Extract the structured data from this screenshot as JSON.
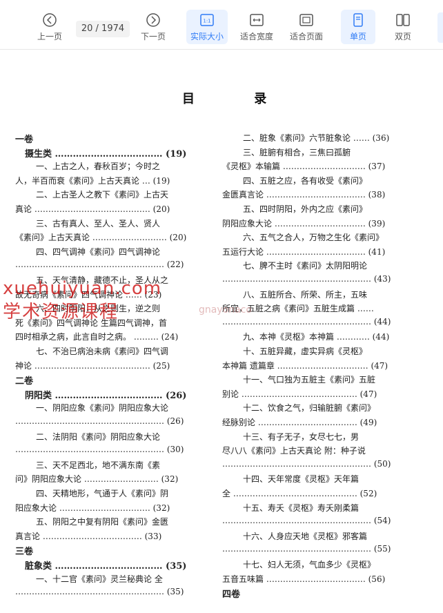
{
  "toolbar": {
    "prev_label": "上一页",
    "page_indicator": "20 / 1974",
    "next_label": "下一页",
    "actual_size_label": "实际大小",
    "fit_width_label": "适合宽度",
    "fit_page_label": "适合页面",
    "single_page_label": "单页",
    "double_page_label": "双页",
    "accent_color": "#2f7bf5"
  },
  "document": {
    "title": "目 录",
    "left_column": [
      {
        "text": "一卷",
        "kind": "vol"
      },
      {
        "text": "摄生类 ……………………………… (19)",
        "kind": "cat"
      },
      {
        "text": "一、上古之人，春秋百岁；今时之",
        "kind": "entry"
      },
      {
        "text": "人，半百而衰《素问》上古天真论 … (19)",
        "kind": "entry"
      },
      {
        "text": "二、上古圣人之教下《素问》上古天",
        "kind": "entry"
      },
      {
        "text": "真论 …………………………………… (20)",
        "kind": "entry"
      },
      {
        "text": "三、古有真人、至人、圣人、贤人",
        "kind": "entry"
      },
      {
        "text": "《素问》上古天真论 ……………………… (20)",
        "kind": "entry"
      },
      {
        "text": "四、四气调神《素问》四气调神论",
        "kind": "entry"
      },
      {
        "text": "……………………………………………… (22)",
        "kind": "entry"
      },
      {
        "text": "五、天气清静，藏德不止，圣人从之",
        "kind": "entry"
      },
      {
        "text": "故无奇病《素问》四气调神论 …… (23)",
        "kind": "entry"
      },
      {
        "text": "六、四时阴阳，从之则生，逆之则",
        "kind": "entry"
      },
      {
        "text": "死《素问》四气调神论 生篇四气调神，首",
        "kind": "entry"
      },
      {
        "text": "四时相承之病，此言自时之病。 ……… (24)",
        "kind": "entry"
      },
      {
        "text": "七、不治已病治未病《素问》四气调",
        "kind": "entry"
      },
      {
        "text": "神论 …………………………………… (25)",
        "kind": "entry"
      },
      {
        "text": "二卷",
        "kind": "vol"
      },
      {
        "text": "阴阳类 ……………………………… (26)",
        "kind": "cat"
      },
      {
        "text": "一、阴阳应象《素问》阴阳应象大论",
        "kind": "entry"
      },
      {
        "text": "……………………………………………… (26)",
        "kind": "entry"
      },
      {
        "text": "二、法阴阳《素问》阴阳应象大论",
        "kind": "entry"
      },
      {
        "text": "……………………………………………… (30)",
        "kind": "entry"
      },
      {
        "text": "三、天不足西北，地不满东南《素",
        "kind": "entry"
      },
      {
        "text": "问》阴阳应象大论 ……………………… (32)",
        "kind": "entry"
      },
      {
        "text": "四、天精地形，气通于人《素问》阴",
        "kind": "entry"
      },
      {
        "text": "阳应象大论 …………………………… (32)",
        "kind": "entry"
      },
      {
        "text": "五、阴阳之中复有阴阳《素问》金匮",
        "kind": "entry"
      },
      {
        "text": "真言论 ……………………………… (33)",
        "kind": "entry"
      },
      {
        "text": "三卷",
        "kind": "vol"
      },
      {
        "text": "脏象类 ……………………………… (35)",
        "kind": "cat"
      },
      {
        "text": "一、十二官《素问》灵兰秘典论 全",
        "kind": "entry"
      },
      {
        "text": "……………………………………………… (35)",
        "kind": "entry"
      }
    ],
    "right_column": [
      {
        "text": "二、脏象《素问》六节脏象论 …… (36)",
        "kind": "entry"
      },
      {
        "text": "三、脏腑有相合，三焦曰孤腑",
        "kind": "entry"
      },
      {
        "text": "《灵枢》本输篇 ………………………… (37)",
        "kind": "entry"
      },
      {
        "text": "四、五脏之应，各有收受《素问》",
        "kind": "entry"
      },
      {
        "text": "金匮真言论 ……………………………… (38)",
        "kind": "entry"
      },
      {
        "text": "五、四时阴阳，外内之应《素问》",
        "kind": "entry"
      },
      {
        "text": "阴阳应象大论 …………………………… (39)",
        "kind": "entry"
      },
      {
        "text": "六、五气之合人，万物之生化《素问》",
        "kind": "entry"
      },
      {
        "text": "五运行大论 ……………………………… (41)",
        "kind": "entry"
      },
      {
        "text": "七、脾不主时《素问》太阴阳明论",
        "kind": "entry"
      },
      {
        "text": "……………………………………………… (43)",
        "kind": "entry"
      },
      {
        "text": "八、五脏所合、所荣、所主，五味",
        "kind": "entry"
      },
      {
        "text": "所宜，五脏之病《素问》五脏生成篇 ……",
        "kind": "entry"
      },
      {
        "text": "……………………………………………… (44)",
        "kind": "entry"
      },
      {
        "text": "九、本神《灵枢》本神篇 ………… (44)",
        "kind": "entry"
      },
      {
        "text": "十、五脏异藏，虚实异病《灵枢》",
        "kind": "entry"
      },
      {
        "text": "本神篇 遗篇章 …………………………… (47)",
        "kind": "entry"
      },
      {
        "text": "十一、气口独为五脏主《素问》五脏",
        "kind": "entry"
      },
      {
        "text": "别论 …………………………………… (47)",
        "kind": "entry"
      },
      {
        "text": "十二、饮食之气，归输脏腑《素问》",
        "kind": "entry"
      },
      {
        "text": "经脉别论 ……………………………… (49)",
        "kind": "entry"
      },
      {
        "text": "十三、有子无子，女尽七七，男",
        "kind": "entry"
      },
      {
        "text": "尽八八《素问》上古天真论 附：种子说",
        "kind": "entry"
      },
      {
        "text": "……………………………………………… (50)",
        "kind": "entry"
      },
      {
        "text": "十四、天年常度《灵枢》天年篇",
        "kind": "entry"
      },
      {
        "text": "全 ……………………………………… (52)",
        "kind": "entry"
      },
      {
        "text": "十五、寿夭《灵枢》寿夭刚柔篇",
        "kind": "entry"
      },
      {
        "text": "……………………………………………… (54)",
        "kind": "entry"
      },
      {
        "text": "十六、人身应天地《灵枢》邪客篇",
        "kind": "entry"
      },
      {
        "text": "……………………………………………… (55)",
        "kind": "entry"
      },
      {
        "text": "十七、妇人无须，气血多少《灵枢》",
        "kind": "entry"
      },
      {
        "text": "五音五味篇 ……………………………… (56)",
        "kind": "entry"
      },
      {
        "text": "四卷",
        "kind": "vol"
      }
    ],
    "watermark_1": "xuehuiyuan.com",
    "watermark_2": "学术资源课程",
    "watermark_3": "gnayonaco"
  }
}
